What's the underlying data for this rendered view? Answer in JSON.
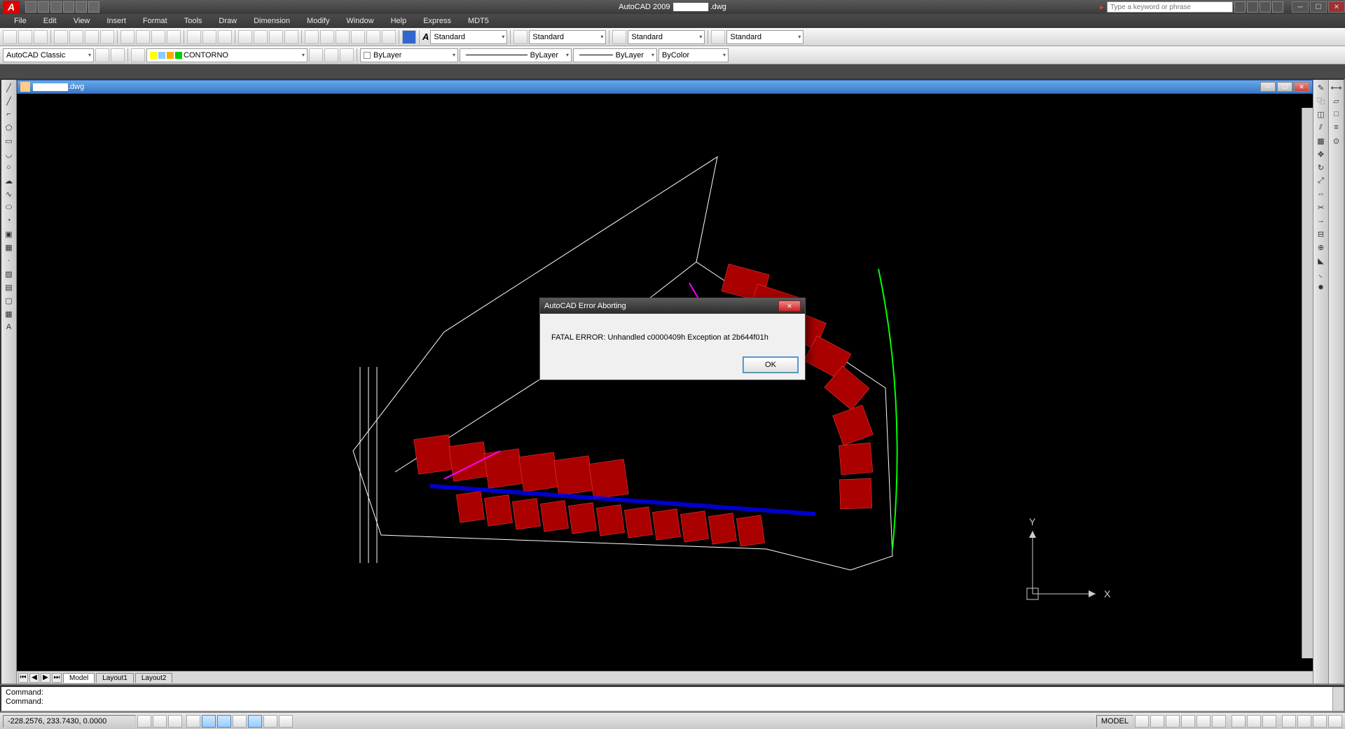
{
  "app": {
    "title_prefix": "AutoCAD 2009",
    "title_suffix": ".dwg",
    "search_placeholder": "Type a keyword or phrase"
  },
  "menu": [
    "File",
    "Edit",
    "View",
    "Insert",
    "Format",
    "Tools",
    "Draw",
    "Dimension",
    "Modify",
    "Window",
    "Help",
    "Express",
    "MDT5"
  ],
  "toolbars": {
    "styles": {
      "text": "Standard",
      "dim": "Standard",
      "table": "Standard",
      "mleader": "Standard"
    },
    "workspace": "AutoCAD Classic",
    "layer": "CONTORNO",
    "color": "ByLayer",
    "linetype": "ByLayer",
    "lineweight": "ByLayer",
    "plotstyle": "ByColor"
  },
  "document": {
    "ext": ".dwg"
  },
  "tabs": {
    "model": "Model",
    "l1": "Layout1",
    "l2": "Layout2"
  },
  "ucs": {
    "x": "X",
    "y": "Y"
  },
  "command": {
    "l1": "Command:",
    "l2": "Command:"
  },
  "status": {
    "coords": "-228.2576, 233.7430, 0.0000",
    "model": "MODEL"
  },
  "error": {
    "title": "AutoCAD Error Aborting",
    "msg": "FATAL ERROR:  Unhandled c0000409h Exception at 2b644f01h",
    "ok": "OK"
  }
}
